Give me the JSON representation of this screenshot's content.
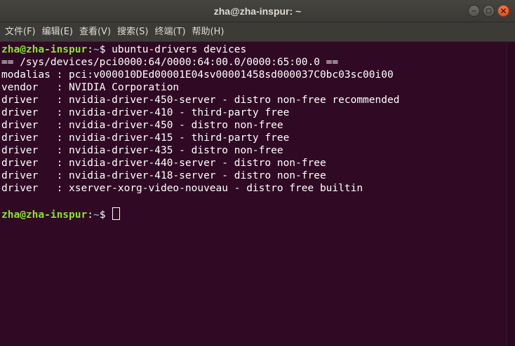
{
  "window": {
    "title": "zha@zha-inspur: ~"
  },
  "menu": [
    {
      "label": "文件(F)"
    },
    {
      "label": "编辑(E)"
    },
    {
      "label": "查看(V)"
    },
    {
      "label": "搜索(S)"
    },
    {
      "label": "终端(T)"
    },
    {
      "label": "帮助(H)"
    }
  ],
  "prompt": {
    "user": "zha@zha-inspur",
    "sep": ":",
    "path": "~",
    "symbol": "$ "
  },
  "command": "ubuntu-drivers devices",
  "output": [
    "== /sys/devices/pci0000:64/0000:64:00.0/0000:65:00.0 ==",
    "modalias : pci:v000010DEd00001E04sv00001458sd000037C0bc03sc00i00",
    "vendor   : NVIDIA Corporation",
    "driver   : nvidia-driver-450-server - distro non-free recommended",
    "driver   : nvidia-driver-410 - third-party free",
    "driver   : nvidia-driver-450 - distro non-free",
    "driver   : nvidia-driver-415 - third-party free",
    "driver   : nvidia-driver-435 - distro non-free",
    "driver   : nvidia-driver-440-server - distro non-free",
    "driver   : nvidia-driver-418-server - distro non-free",
    "driver   : xserver-xorg-video-nouveau - distro free builtin",
    ""
  ],
  "colors": {
    "background": "#300a24",
    "prompt_user": "#8ae234",
    "prompt_path": "#729fcf",
    "text": "#ffffff"
  }
}
